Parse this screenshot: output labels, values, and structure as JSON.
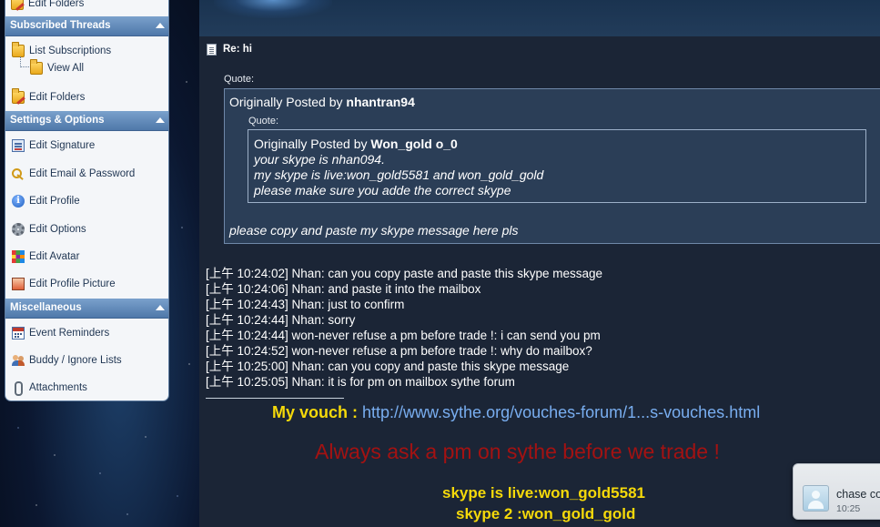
{
  "sidebar": {
    "top_item": "Edit Folders",
    "sections": [
      {
        "header": "Subscribed Threads"
      },
      {
        "header": "Settings & Options"
      },
      {
        "header": "Miscellaneous"
      }
    ],
    "subscribed": {
      "list_subscriptions": "List Subscriptions",
      "view_all": "View All",
      "edit_folders": "Edit Folders"
    },
    "settings": {
      "edit_signature": "Edit Signature",
      "edit_email_password": "Edit Email & Password",
      "edit_profile": "Edit Profile",
      "edit_options": "Edit Options",
      "edit_avatar": "Edit Avatar",
      "edit_profile_picture": "Edit Profile Picture"
    },
    "misc": {
      "event_reminders": "Event Reminders",
      "buddy_ignore": "Buddy / Ignore Lists",
      "attachments": "Attachments"
    }
  },
  "post": {
    "title": "Re: hi",
    "quote_label": "Quote:",
    "outer_quote": {
      "prefix": "Originally Posted by ",
      "author": "nhantran94",
      "reply": "please copy and paste my skype message here pls"
    },
    "inner_quote": {
      "label": "Quote:",
      "prefix": "Originally Posted by ",
      "author": "Won_gold o_0",
      "lines": [
        "your skype is nhan094.",
        "my skype is live:won_gold5581 and won_gold_gold",
        "please make sure you adde the correct skype"
      ]
    },
    "chat_log": [
      "[上午 10:24:02] Nhan: can you copy paste and paste this skype message",
      "[上午 10:24:06] Nhan: and paste it into the mailbox",
      "[上午 10:24:43] Nhan: just to confirm",
      "[上午 10:24:44] Nhan: sorry",
      "[上午 10:24:44] won-never refuse a pm before trade !: i can send you pm",
      "[上午 10:24:52] won-never refuse a pm before trade !: why do mailbox?",
      "[上午 10:25:00] Nhan: can you copy and paste this skype message",
      "[上午 10:25:05] Nhan: it is for pm on mailbox sythe forum"
    ]
  },
  "signature": {
    "vouch_label": "My vouch : ",
    "vouch_url": "http://www.sythe.org/vouches-forum/1...s-vouches.html",
    "warning": "Always ask a pm on sythe before we trade !",
    "skype1": "skype is live:won_gold5581",
    "skype2": "skype 2 :won_gold_gold"
  },
  "notification": {
    "name": "chase co",
    "time": "10:25"
  },
  "colors": {
    "page_bg": "#1b2536",
    "sidebar_header": "#5b84b4",
    "quote_bg": "#2b3e57",
    "vouch_yellow": "#f5d90a",
    "link_blue": "#79aef0",
    "warning_red": "#a31212"
  }
}
